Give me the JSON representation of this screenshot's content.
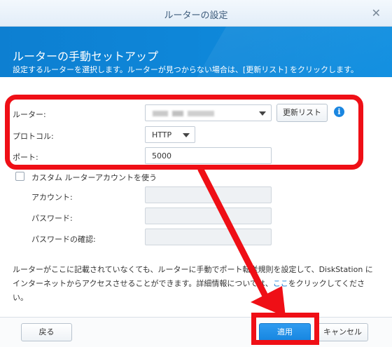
{
  "dialog": {
    "title": "ルーターの設定"
  },
  "header": {
    "heading": "ルーターの手動セットアップ",
    "subtitle": "設定するルーターを選択します。ルーターが見つからない場合は、[更新リスト] をクリックします。",
    "accent": "#0d7fd1"
  },
  "form": {
    "router_label": "ルーター:",
    "router_value": "",
    "refresh_label": "更新リスト",
    "info_glyph": "i",
    "protocol_label": "プロトコル:",
    "protocol_value": "HTTP",
    "port_label": "ポート:",
    "port_value": "5000",
    "custom_account_label": "カスタム ルーターアカウントを使う",
    "account_label": "アカウント:",
    "password_label": "パスワード:",
    "password_confirm_label": "パスワードの確認:"
  },
  "description": {
    "text_before": "ルーターがここに記載されていなくても、ルーターに手動でポート転送規則を設定して、DiskStation にインターネットからアクセスさせることができます。詳細情報については、",
    "link": "ここ",
    "text_after": "をクリックしてください。"
  },
  "footer": {
    "back_label": "戻る",
    "apply_label": "適用",
    "cancel_label": "キャンセル"
  },
  "annotation": {
    "color": "#ef0f16"
  },
  "icons": {
    "close": "close-icon",
    "info": "info-icon",
    "dropdown": "chevron-down-icon"
  }
}
